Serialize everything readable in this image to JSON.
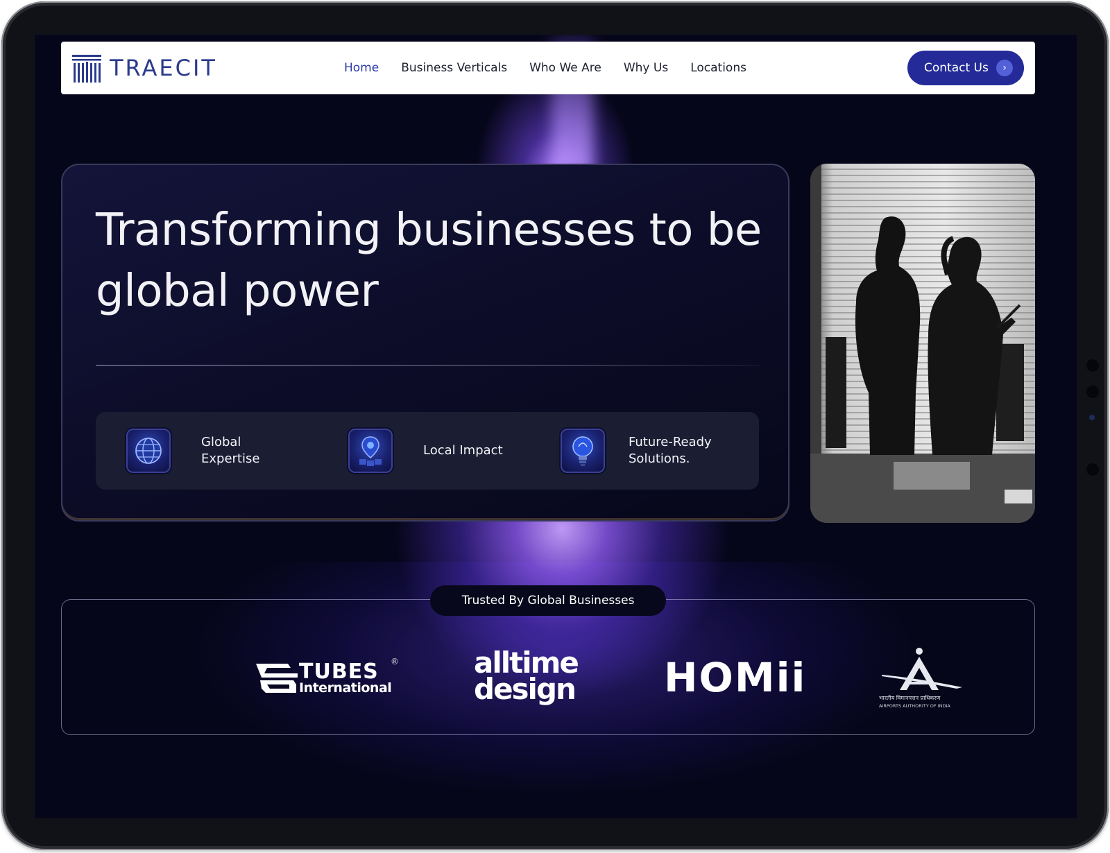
{
  "brand": {
    "logo_text": "TRAECIT"
  },
  "nav": {
    "links": [
      {
        "label": "Home",
        "active": true
      },
      {
        "label": "Business Verticals",
        "active": false
      },
      {
        "label": "Who We Are",
        "active": false
      },
      {
        "label": "Why Us",
        "active": false
      },
      {
        "label": "Locations",
        "active": false
      }
    ],
    "contact_label": "Contact Us",
    "contact_icon": "chevron-right-icon"
  },
  "hero": {
    "title": "Transforming businesses to be global power",
    "features": [
      {
        "label": "Global\nExpertise",
        "icon": "globe-icon"
      },
      {
        "label": "Local Impact",
        "icon": "location-pin-icon"
      },
      {
        "label": "Future-Ready\nSolutions.",
        "icon": "lightbulb-icon"
      }
    ]
  },
  "trusted": {
    "heading": "Trusted By Global Businesses",
    "logos": [
      {
        "name": "tubes-international-logo",
        "line1": "TUBES",
        "line2": "International",
        "mark": "®"
      },
      {
        "name": "alltime-design-logo",
        "line1": "alltime",
        "line2": "design"
      },
      {
        "name": "homii-logo",
        "text": "HOMii"
      },
      {
        "name": "airports-authority-of-india-logo",
        "line1": "भारतीय विमानपत्तन प्राधिकरण",
        "line2": "AIRPORTS AUTHORITY OF INDIA"
      }
    ]
  },
  "colors": {
    "nav_active": "#2c3aa8",
    "contact_button": "#242b98",
    "background": "#06061a",
    "glow": "#a876ff"
  }
}
